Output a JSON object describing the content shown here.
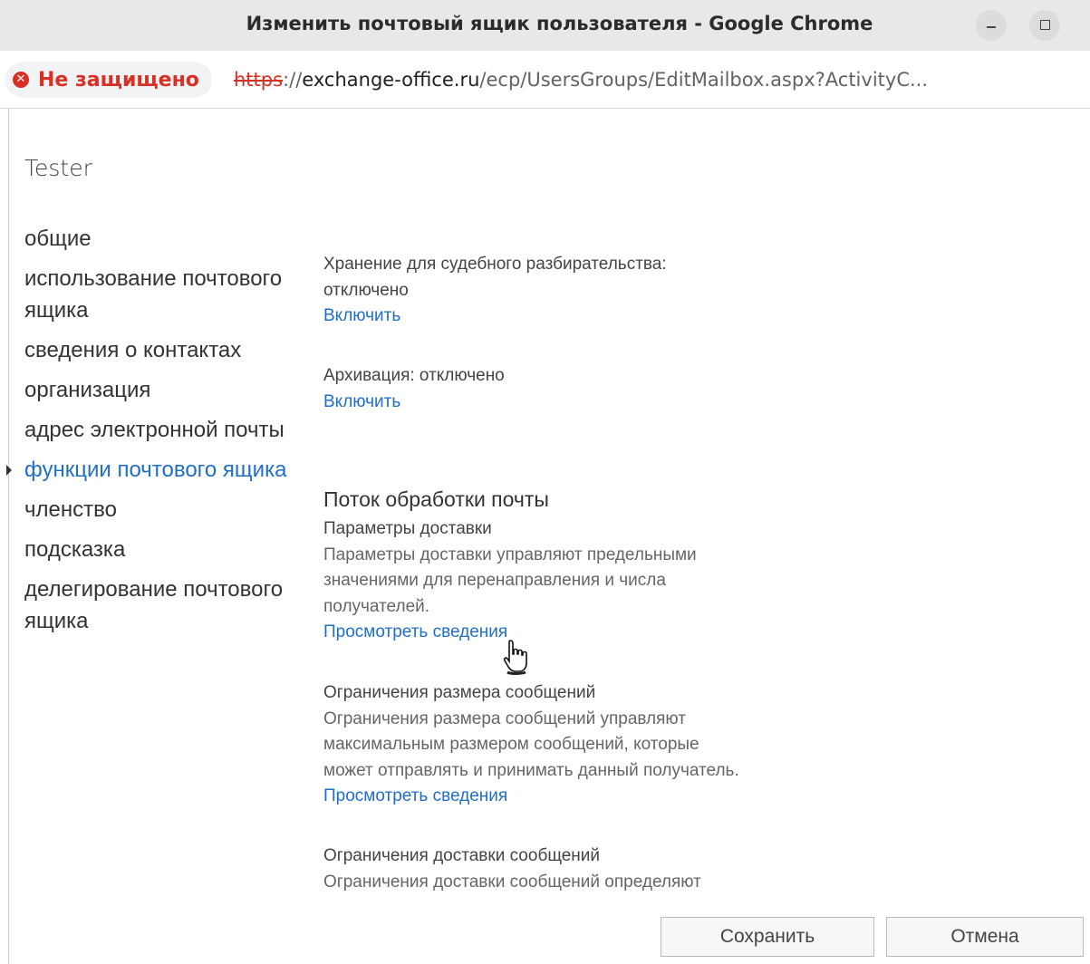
{
  "window": {
    "title": "Изменить почтовый ящик пользователя - Google Chrome"
  },
  "address_bar": {
    "security_label": "Не защищено",
    "url_scheme": "https",
    "url_sep": "://",
    "url_host": "exchange-office.ru",
    "url_path": "/ecp/UsersGroups/EditMailbox.aspx?ActivityC..."
  },
  "user_name": "Tester",
  "nav": {
    "items": [
      {
        "label": "общие"
      },
      {
        "label": "использование почтового ящика"
      },
      {
        "label": "сведения о контактах"
      },
      {
        "label": "организация"
      },
      {
        "label": "адрес электронной почты"
      },
      {
        "label": "функции почтового ящика",
        "active": true
      },
      {
        "label": "членство"
      },
      {
        "label": "подсказка"
      },
      {
        "label": "делегирование почтового ящика"
      }
    ]
  },
  "litigation_hold": {
    "label": "Хранение для судебного разбирательства:",
    "status": "отключено",
    "link": "Включить"
  },
  "archiving": {
    "label": "Архивация: отключено",
    "link": "Включить"
  },
  "mail_flow": {
    "title": "Поток обработки почты",
    "delivery_options": {
      "title": "Параметры доставки",
      "desc_1": "Параметры доставки управляют предельными",
      "desc_2": "значениями для перенаправления и числа",
      "desc_3": "получателей.",
      "link": "Просмотреть сведения"
    },
    "message_size": {
      "title": "Ограничения размера сообщений",
      "desc_1": "Ограничения размера сообщений управляют",
      "desc_2": "максимальным размером сообщений, которые",
      "desc_3": "может отправлять и принимать данный получатель.",
      "link": "Просмотреть сведения"
    },
    "delivery_restrictions": {
      "title": "Ограничения доставки сообщений",
      "desc_1": "Ограничения доставки сообщений определяют"
    }
  },
  "buttons": {
    "save": "Сохранить",
    "cancel": "Отмена"
  }
}
